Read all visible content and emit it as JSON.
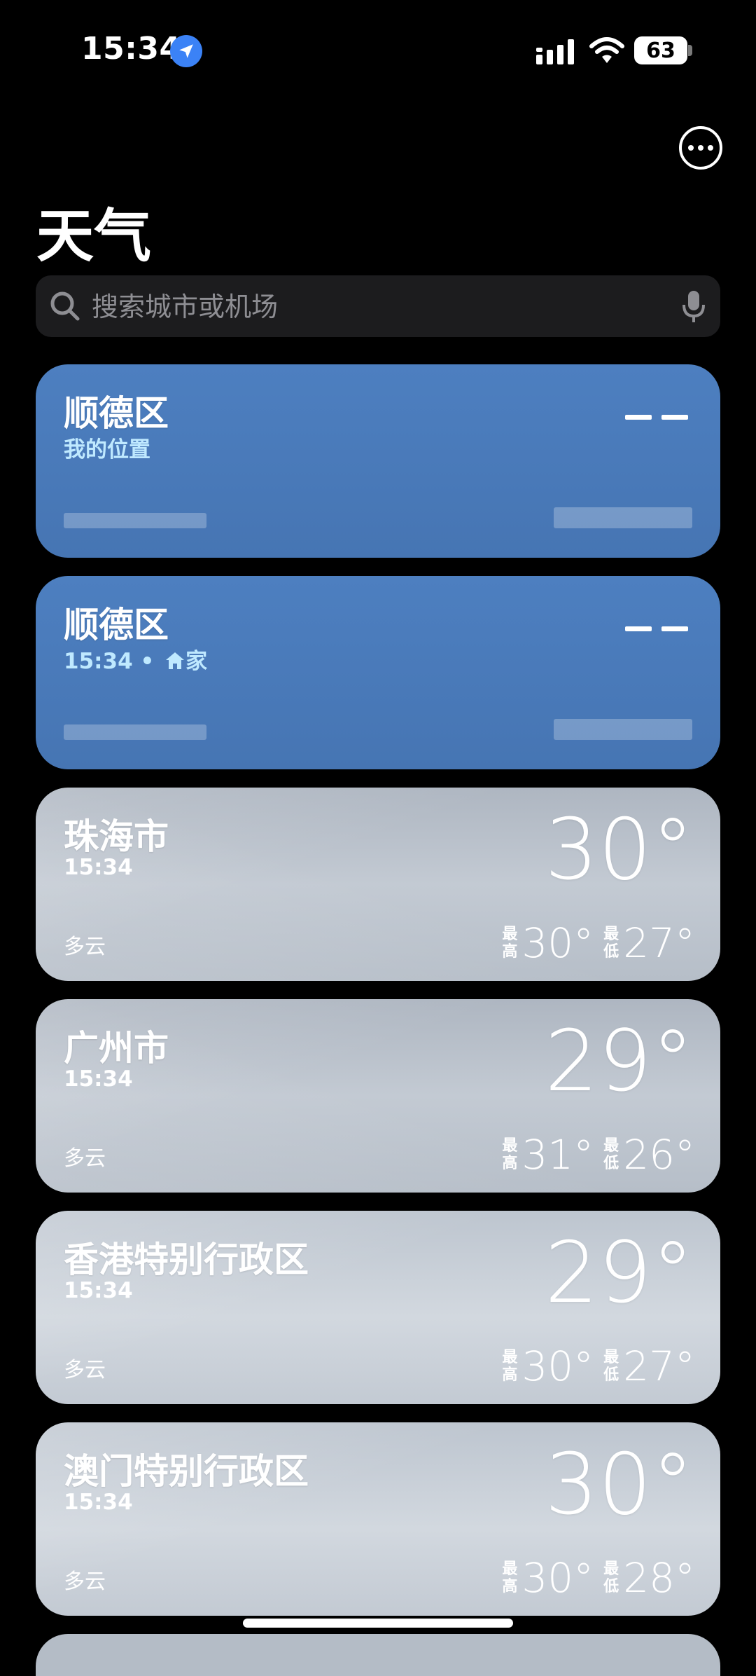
{
  "status": {
    "time": "15:34",
    "battery": "63"
  },
  "title": "天气",
  "search": {
    "placeholder": "搜索城市或机场"
  },
  "cards": [
    {
      "city": "顺德区",
      "subtitle": "我的位置",
      "style": "blue"
    },
    {
      "city": "顺德区",
      "time": "15:34",
      "separator": "•",
      "home_label": "家",
      "style": "blue"
    },
    {
      "city": "珠海市",
      "time": "15:34",
      "condition": "多云",
      "temp": "30°",
      "high_label": "最高",
      "high": "30°",
      "low_label": "最低",
      "low": "27°"
    },
    {
      "city": "广州市",
      "time": "15:34",
      "condition": "多云",
      "temp": "29°",
      "high_label": "最高",
      "high": "31°",
      "low_label": "最低",
      "low": "26°"
    },
    {
      "city": "香港特别行政区",
      "time": "15:34",
      "condition": "多云",
      "temp": "29°",
      "high_label": "最高",
      "high": "30°",
      "low_label": "最低",
      "low": "27°"
    },
    {
      "city": "澳门特别行政区",
      "time": "15:34",
      "condition": "多云",
      "temp": "30°",
      "high_label": "最高",
      "high": "30°",
      "low_label": "最低",
      "low": "28°"
    }
  ],
  "icons": {
    "location": "location-arrow-icon",
    "signal": "cellular-signal-icon",
    "wifi": "wifi-icon",
    "battery": "battery-icon",
    "more": "ellipsis-circle-icon",
    "search": "search-icon",
    "mic": "microphone-icon",
    "home": "house-icon"
  },
  "colors": {
    "accent": "#3b82f6",
    "card_blue": "#4a7bbb",
    "background": "#000000"
  }
}
